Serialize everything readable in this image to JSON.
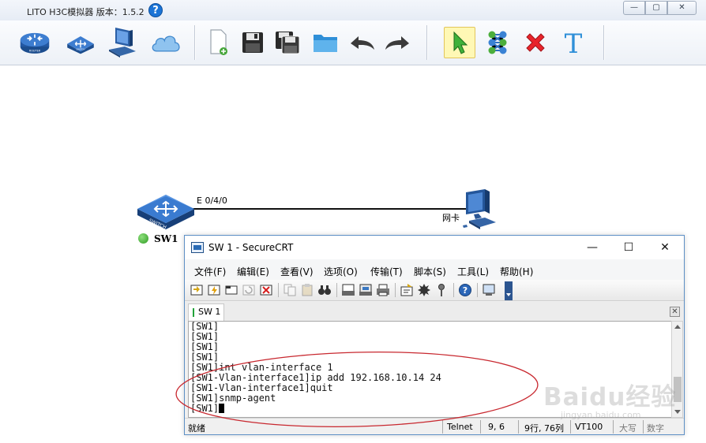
{
  "main_window": {
    "title": "LITO H3C模拟器 版本：1.5.2",
    "help_icon": "?",
    "controls": {
      "minimize": "—",
      "maximize": "▢",
      "close": "✕"
    }
  },
  "toolbar_icons": [
    {
      "name": "router-icon",
      "label": "ROUTER"
    },
    {
      "name": "switch-icon",
      "label": "SWITCH"
    },
    {
      "name": "pc-icon"
    },
    {
      "name": "cloud-icon"
    },
    {
      "name": "new-file-icon"
    },
    {
      "name": "save-icon"
    },
    {
      "name": "save-as-icon"
    },
    {
      "name": "open-folder-icon"
    },
    {
      "name": "undo-icon"
    },
    {
      "name": "redo-icon"
    },
    {
      "name": "select-pointer-icon"
    },
    {
      "name": "connect-icon"
    },
    {
      "name": "delete-icon"
    },
    {
      "name": "text-icon",
      "label": "T"
    }
  ],
  "topology": {
    "switch": {
      "name": "SW1",
      "label": "SWITCH",
      "status": "up",
      "status_color": "#3bb32c"
    },
    "link": {
      "port": "E 0/4/0"
    },
    "pc": {
      "name": "网卡"
    }
  },
  "crt": {
    "title": "SW 1 - SecureCRT",
    "controls": {
      "minimize": "—",
      "maximize": "☐",
      "close": "✕"
    },
    "menu": [
      "文件(F)",
      "编辑(E)",
      "查看(V)",
      "选项(O)",
      "传输(T)",
      "脚本(S)",
      "工具(L)",
      "帮助(H)"
    ],
    "toolbar": [
      {
        "name": "connect-icon"
      },
      {
        "name": "quick-connect-icon"
      },
      {
        "name": "connect-in-tab-icon"
      },
      {
        "name": "reconnect-icon",
        "disabled": true
      },
      {
        "name": "disconnect-icon"
      },
      {
        "name": "copy-icon",
        "disabled": true
      },
      {
        "name": "paste-icon",
        "disabled": true
      },
      {
        "name": "find-icon"
      },
      {
        "name": "print-setup-icon"
      },
      {
        "name": "print-screen-icon"
      },
      {
        "name": "print-icon"
      },
      {
        "name": "session-options-icon"
      },
      {
        "name": "global-options-icon"
      },
      {
        "name": "keymap-icon"
      },
      {
        "name": "help-icon"
      },
      {
        "name": "screen-icon"
      }
    ],
    "tab": {
      "label": "SW 1",
      "close": "✕"
    },
    "terminal_lines": [
      "[SW1]",
      "[SW1]",
      "[SW1]",
      "[SW1]",
      "[SW1]int vlan-interface 1",
      "[SW1-Vlan-interface1]ip add 192.168.10.14 24",
      "[SW1-Vlan-interface1]quit",
      "[SW1]snmp-agent"
    ],
    "prompt": "[SW1]",
    "status": {
      "ready": "就绪",
      "protocol": "Telnet",
      "cursor_pos": "9,  6",
      "rows_cols": "9行, 76列",
      "emulation": "VT100",
      "caps": "大写",
      "num": "数字"
    }
  },
  "annotation": {
    "color": "#c8282f"
  },
  "watermark": {
    "main": "Baidu经验",
    "sub": "jingyan.baidu.com"
  }
}
